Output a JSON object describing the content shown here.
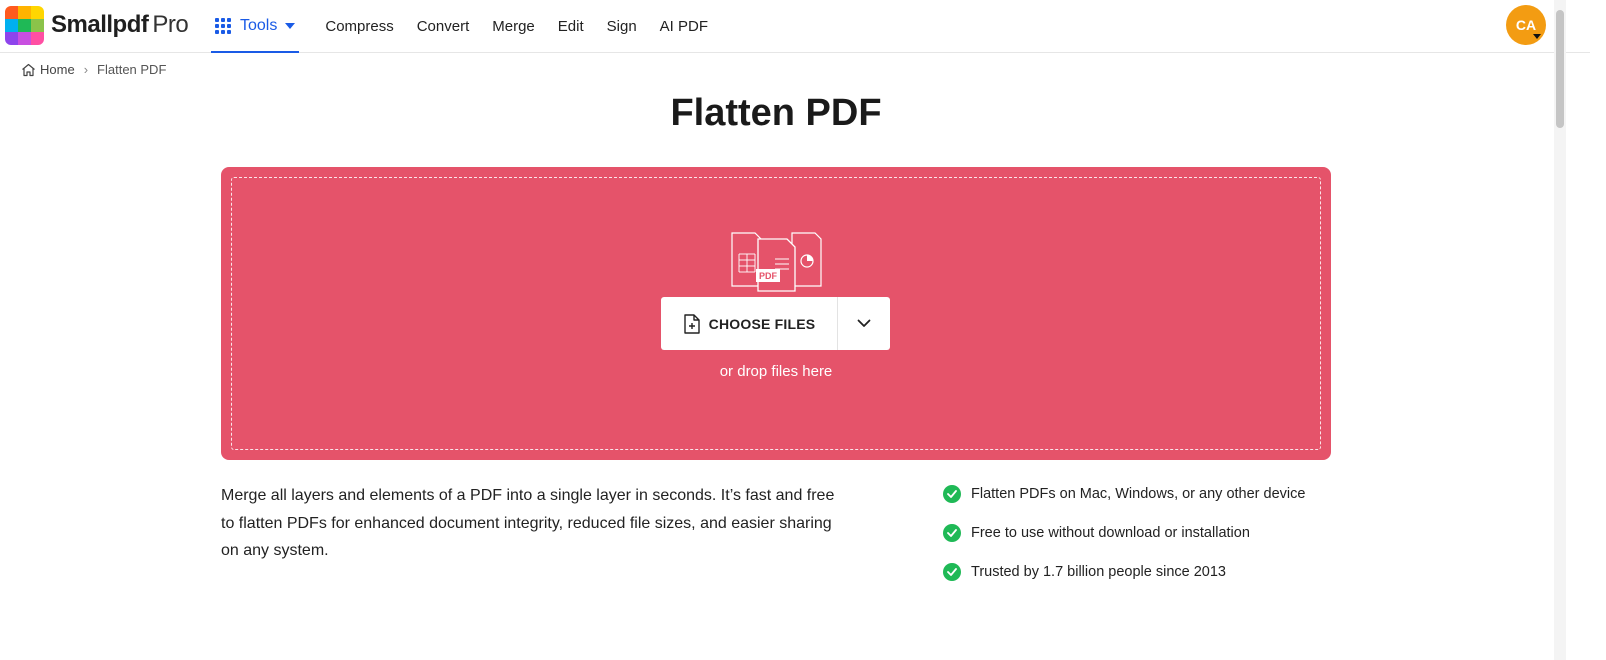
{
  "brand": {
    "name": "Smallpdf",
    "tier": "Pro",
    "colors": [
      "#ff5a1f",
      "#ffb300",
      "#ffd600",
      "#00b0f0",
      "#1fb956",
      "#8bc34a",
      "#8e44ec",
      "#c84fe0",
      "#ff4fa3"
    ]
  },
  "nav": {
    "tools_label": "Tools",
    "links": [
      "Compress",
      "Convert",
      "Merge",
      "Edit",
      "Sign",
      "AI PDF"
    ]
  },
  "user": {
    "initials": "CA",
    "color": "#f39c12"
  },
  "breadcrumb": {
    "home": "Home",
    "current": "Flatten PDF"
  },
  "page": {
    "title": "Flatten PDF"
  },
  "dropzone": {
    "choose_label": "CHOOSE FILES",
    "hint": "or drop files here",
    "background": "#e5536a"
  },
  "description": "Merge all layers and elements of a PDF into a single layer in seconds. It’s fast and free to flatten PDFs for enhanced document integrity, reduced file sizes, and easier sharing on any system.",
  "features": [
    "Flatten PDFs on Mac, Windows, or any other device",
    "Free to use without download or installation",
    "Trusted by 1.7 billion people since 2013"
  ],
  "accent": "#1a5be6",
  "check_color": "#1fb956"
}
